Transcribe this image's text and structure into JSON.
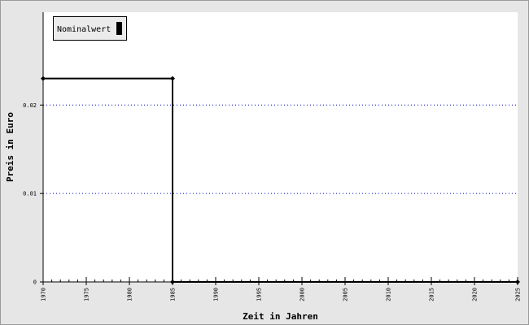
{
  "chart_data": {
    "type": "line",
    "step": true,
    "xlabel": "Zeit in Jahren",
    "ylabel": "Preis in Euro",
    "xlim": [
      1970,
      2025
    ],
    "ylim": [
      0,
      0.0305
    ],
    "x_ticks": [
      1970,
      1975,
      1980,
      1985,
      1990,
      1995,
      2000,
      2005,
      2010,
      2015,
      2020,
      2025
    ],
    "y_ticks": [
      0,
      0.01,
      0.02
    ],
    "y_tick_labels": [
      "0",
      "0.01",
      "0.02"
    ],
    "grid": {
      "y": true,
      "style": "dotted",
      "color": "#0000cc"
    },
    "legend_position": "top-left",
    "series": [
      {
        "name": "Nominalwert",
        "color": "#000000",
        "points": [
          {
            "x": 1970,
            "y": 0.023
          },
          {
            "x": 1985,
            "y": 0.023
          },
          {
            "x": 1985,
            "y": 0
          },
          {
            "x": 2025,
            "y": 0
          }
        ],
        "markers": [
          {
            "x": 1970,
            "y": 0.023
          },
          {
            "x": 1985,
            "y": 0.023
          },
          {
            "x": 1985,
            "y": 0
          },
          {
            "x": 2025,
            "y": 0
          }
        ]
      }
    ]
  }
}
